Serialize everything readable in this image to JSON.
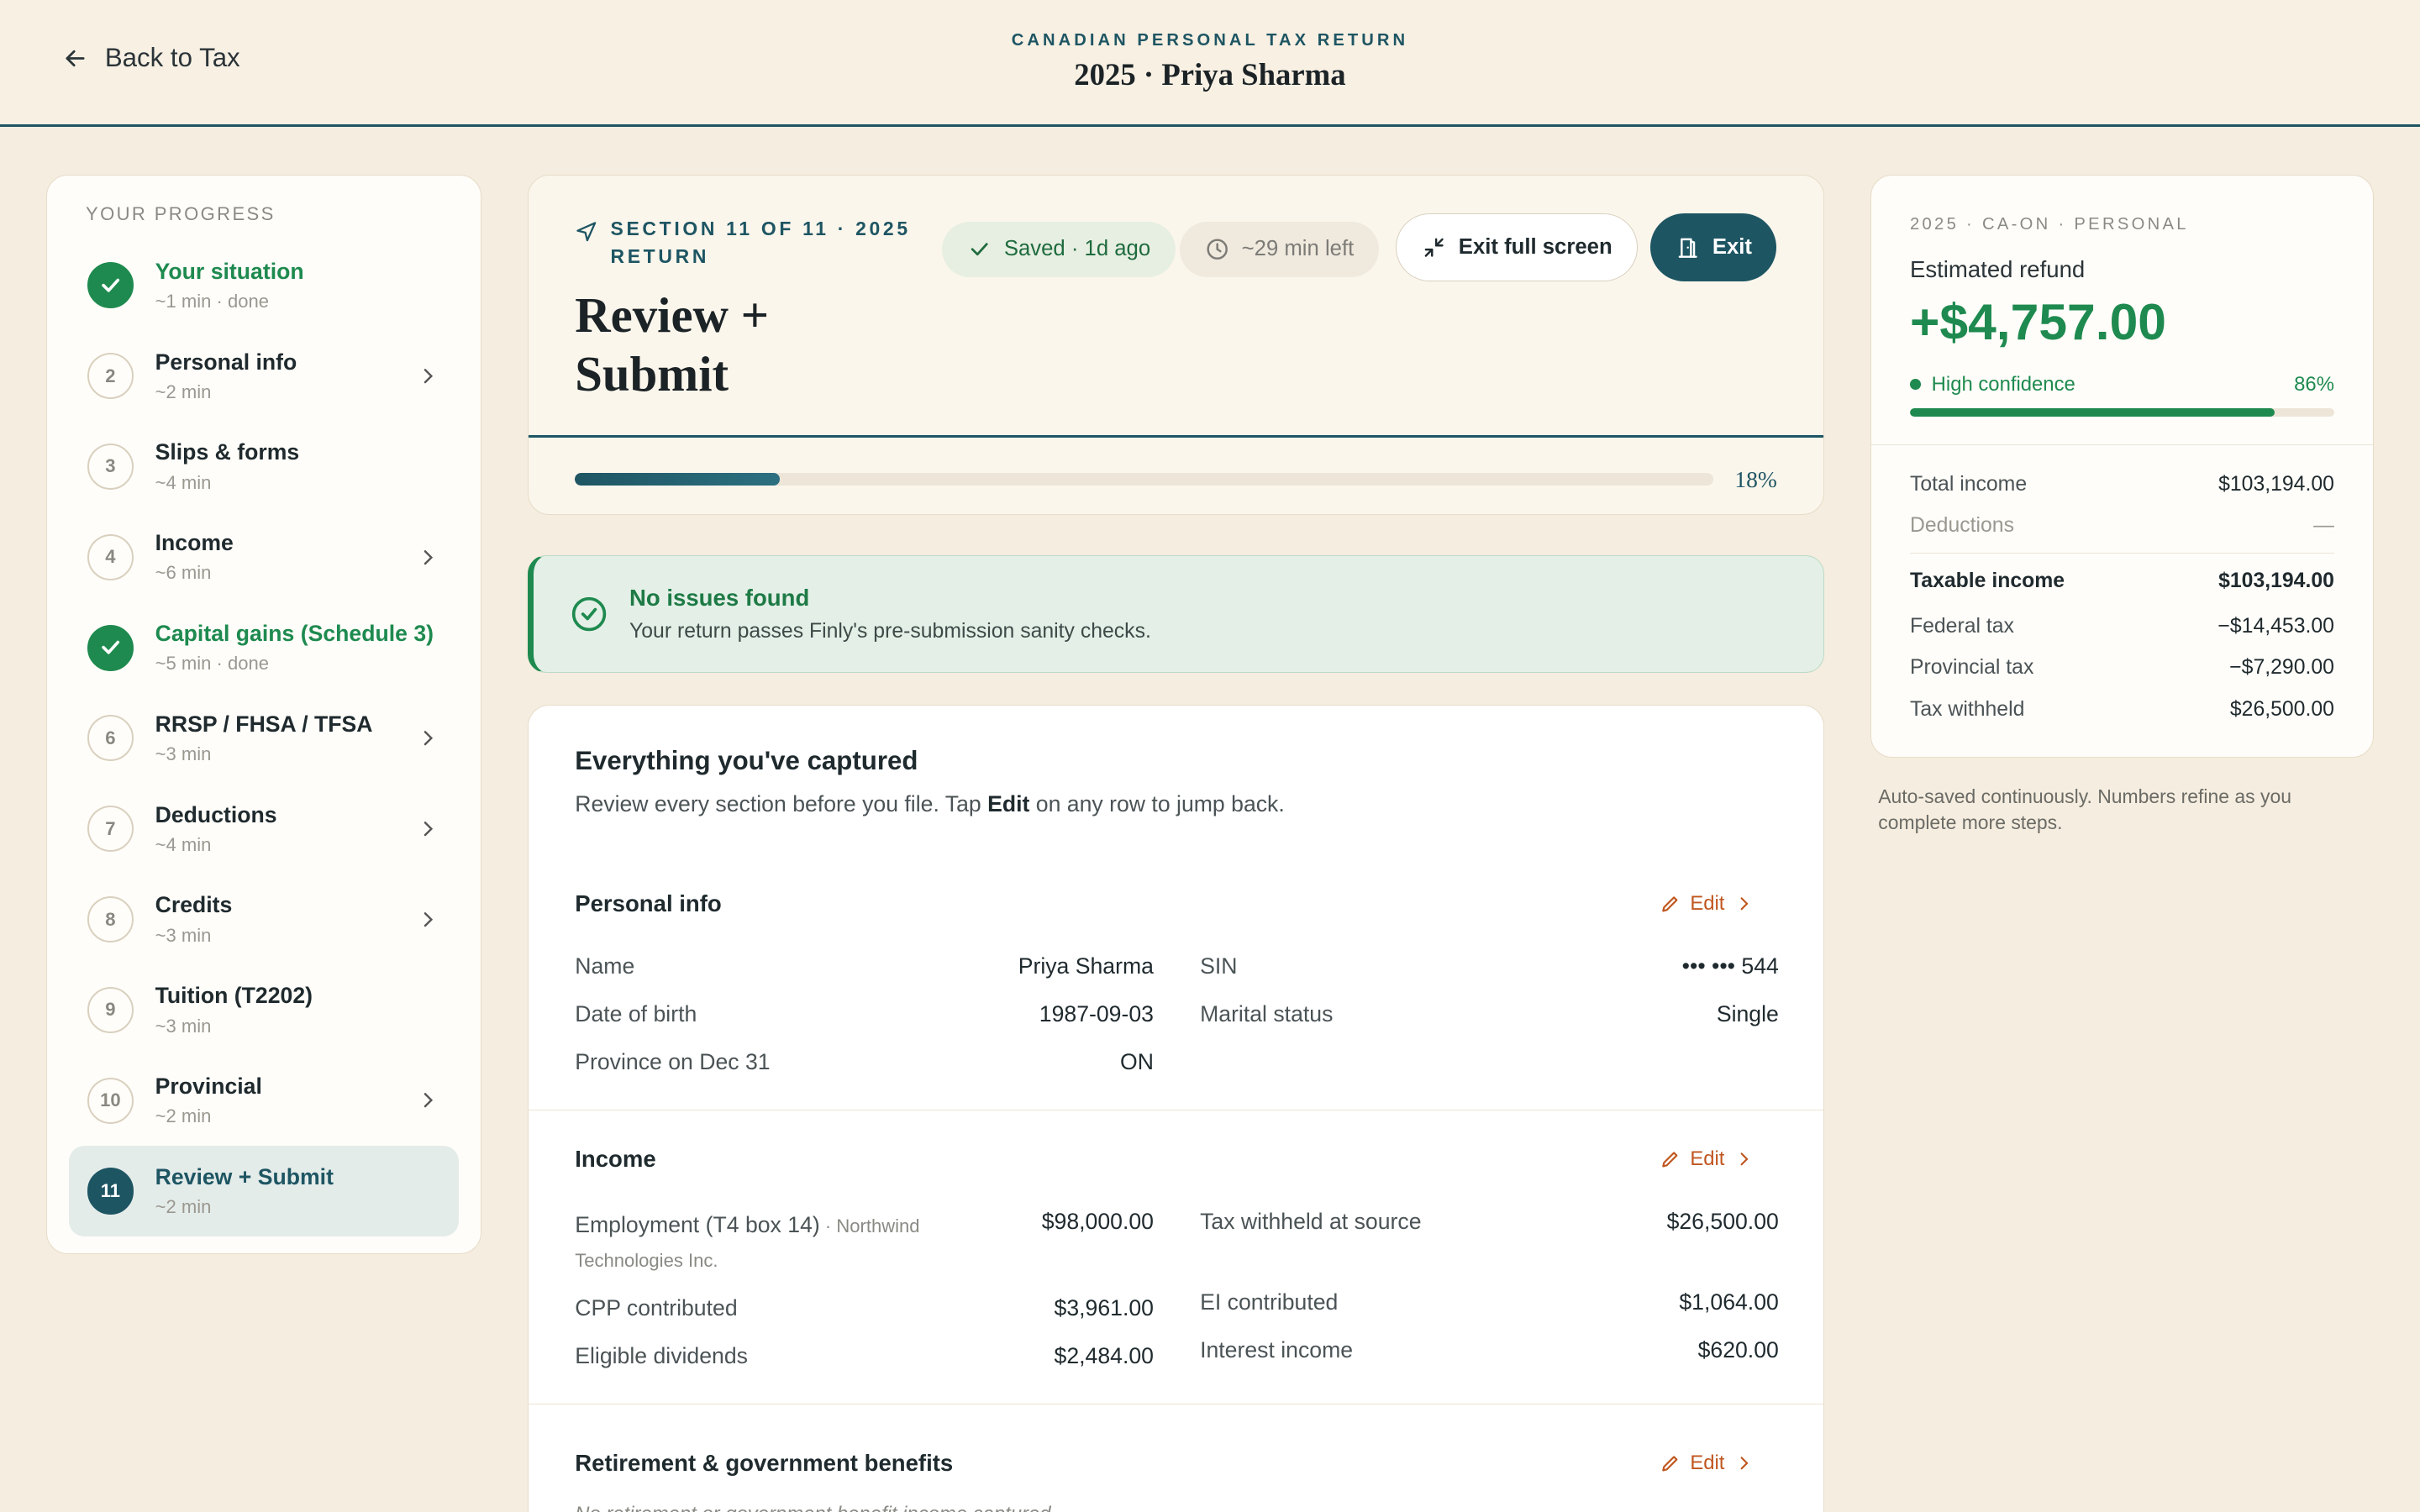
{
  "header": {
    "back_label": "Back to Tax",
    "eyebrow": "CANADIAN PERSONAL TAX RETURN",
    "title": "2025 · Priya Sharma"
  },
  "sidebar": {
    "heading": "YOUR PROGRESS",
    "steps": [
      {
        "num": "1",
        "name": "Your situation",
        "sub": "~1 min · done",
        "state": "done"
      },
      {
        "num": "2",
        "name": "Personal info",
        "sub": "~2 min",
        "state": "todo"
      },
      {
        "num": "3",
        "name": "Slips & forms",
        "sub": "~4 min",
        "state": "todo"
      },
      {
        "num": "4",
        "name": "Income",
        "sub": "~6 min",
        "state": "todo"
      },
      {
        "num": "5",
        "name": "Capital gains (Schedule 3)",
        "sub": "~5 min · done",
        "state": "done"
      },
      {
        "num": "6",
        "name": "RRSP / FHSA / TFSA",
        "sub": "~3 min",
        "state": "todo"
      },
      {
        "num": "7",
        "name": "Deductions",
        "sub": "~4 min",
        "state": "todo"
      },
      {
        "num": "8",
        "name": "Credits",
        "sub": "~3 min",
        "state": "todo"
      },
      {
        "num": "9",
        "name": "Tuition (T2202)",
        "sub": "~3 min",
        "state": "todo"
      },
      {
        "num": "10",
        "name": "Provincial",
        "sub": "~2 min",
        "state": "todo"
      },
      {
        "num": "11",
        "name": "Review + Submit",
        "sub": "~2 min",
        "state": "current"
      }
    ]
  },
  "section": {
    "eyebrow": "SECTION 11 OF 11 · 2025 RETURN",
    "title": "Review + Submit",
    "saved": "Saved · 1d ago",
    "time_left": "~29 min left",
    "exit_full": "Exit full screen",
    "exit": "Exit",
    "progress_label": "18%",
    "progress_fraction": 0.18
  },
  "notice": {
    "title": "No issues found",
    "sub": "Your return passes Finly's pre-submission sanity checks."
  },
  "captured": {
    "title": "Everything you've captured",
    "sub_before": "Review every section before you file. Tap ",
    "sub_bold": "Edit",
    "sub_after": " on any row to jump back.",
    "edit_label": "Edit",
    "personal": {
      "title": "Personal info",
      "left": [
        {
          "k": "Name",
          "v": "Priya Sharma"
        },
        {
          "k": "Date of birth",
          "v": "1987-09-03"
        },
        {
          "k": "Province on Dec 31",
          "v": "ON"
        }
      ],
      "right": [
        {
          "k": "SIN",
          "v": "••• ••• 544"
        },
        {
          "k": "Marital status",
          "v": "Single"
        }
      ]
    },
    "income": {
      "title": "Income",
      "employment_label": "Employment (T4 box 14)",
      "employment_note": " · Northwind Technologies Inc.",
      "employment_value": "$98,000.00",
      "left": [
        {
          "k": "CPP contributed",
          "v": "$3,961.00"
        },
        {
          "k": "Eligible dividends",
          "v": "$2,484.00"
        }
      ],
      "right": [
        {
          "k": "Tax withheld at source",
          "v": "$26,500.00"
        },
        {
          "k": "EI contributed",
          "v": "$1,064.00"
        },
        {
          "k": "Interest income",
          "v": "$620.00"
        }
      ]
    },
    "retirement": {
      "title": "Retirement & government benefits",
      "empty": "No retirement or government benefit income captured."
    }
  },
  "summary": {
    "eyebrow": "2025 · CA-ON · PERSONAL",
    "label": "Estimated refund",
    "amount": "+$4,757.00",
    "confidence_label": "High confidence",
    "confidence_pct": "86%",
    "confidence_fraction": 0.86,
    "rows": [
      {
        "k": "Total income",
        "v": "$103,194.00",
        "style": ""
      },
      {
        "k": "Deductions",
        "v": "—",
        "style": "muted"
      },
      {
        "k": "Taxable income",
        "v": "$103,194.00",
        "style": "bold"
      },
      {
        "k": "Federal tax",
        "v": "−$14,453.00",
        "style": ""
      },
      {
        "k": "Provincial tax",
        "v": "−$7,290.00",
        "style": ""
      },
      {
        "k": "Tax withheld",
        "v": "$26,500.00",
        "style": ""
      }
    ],
    "autosave": "Auto-saved continuously. Numbers refine as you complete more steps."
  },
  "colors": {
    "accent": "#1e5563",
    "success": "#1e8a4f",
    "edit": "#c0561f",
    "background": "#f5eddf"
  }
}
